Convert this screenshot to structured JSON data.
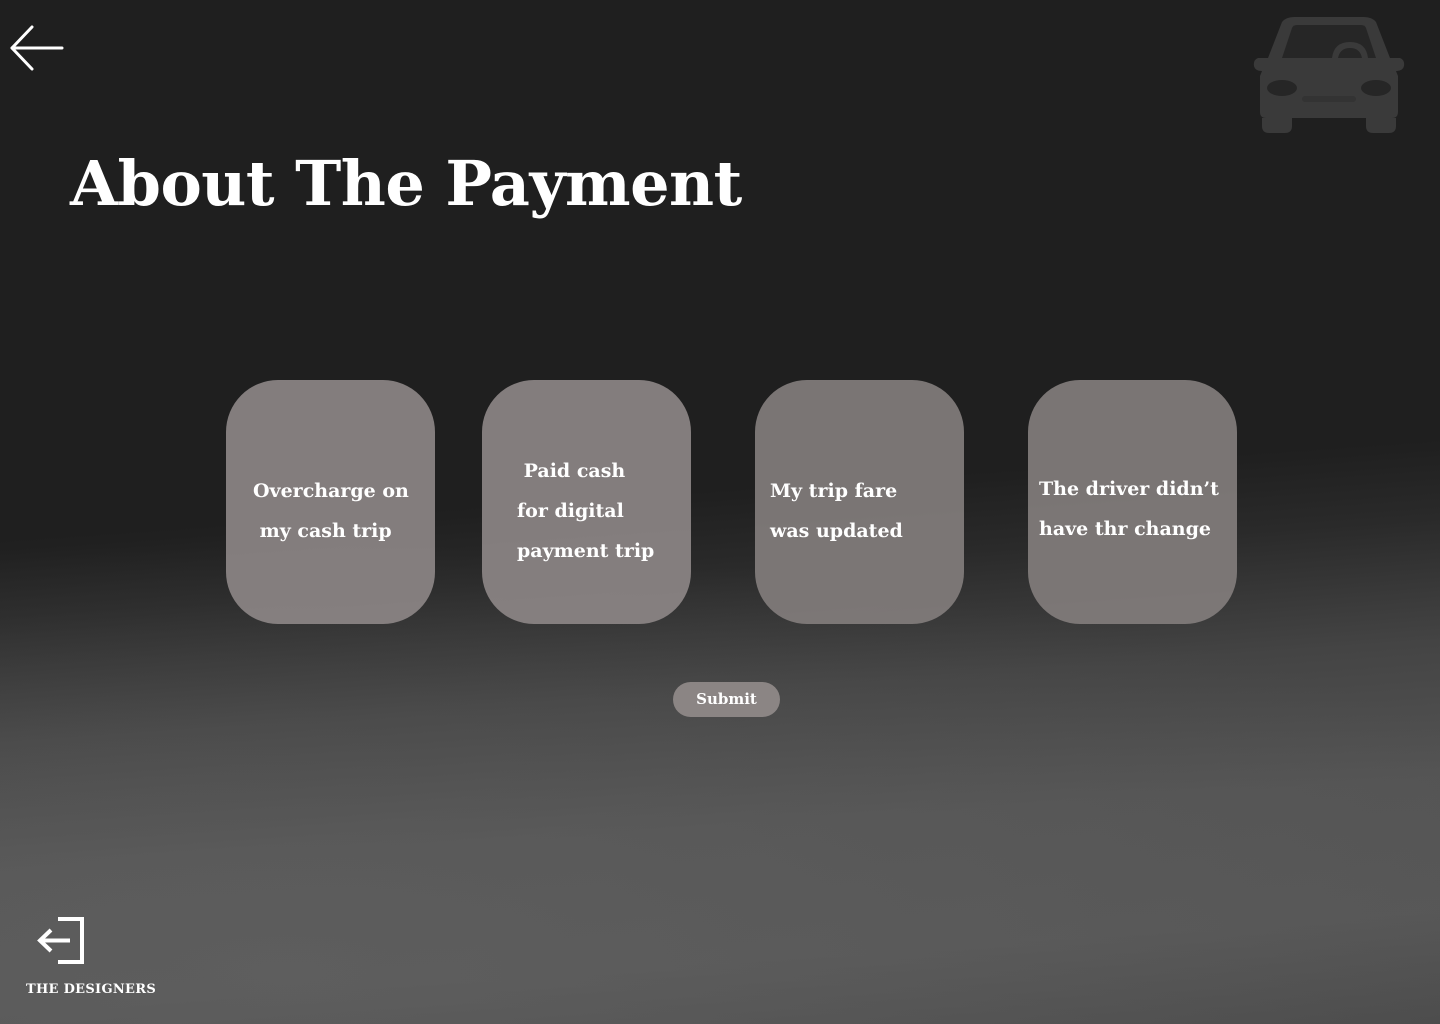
{
  "header": {
    "back_icon": "arrow-left-icon",
    "logo_icon": "car-icon"
  },
  "page": {
    "title": "About The Payment"
  },
  "options": [
    {
      "label": "Overcharge on\n my cash trip"
    },
    {
      "label": " Paid cash\nfor digital\npayment trip"
    },
    {
      "label": "My trip fare\nwas updated"
    },
    {
      "label": "The driver didn’t\nhave thr change"
    }
  ],
  "actions": {
    "submit_label": "Submit"
  },
  "footer": {
    "logout_icon": "logout-icon",
    "brand": "THE DESIGNERS"
  },
  "colors": {
    "background": "#1f1f1f",
    "card": "#8c8685",
    "button": "#8b8584",
    "text": "#ffffff",
    "logo": "#3a3a3a"
  }
}
